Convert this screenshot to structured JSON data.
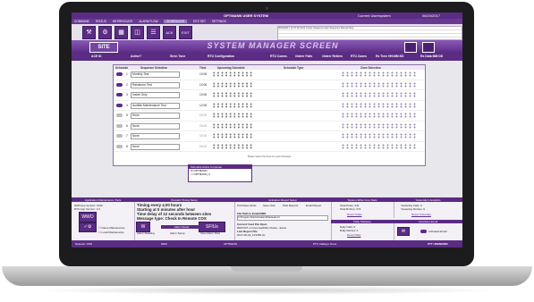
{
  "window": {
    "title": "OPTMANN USER SYSTEM",
    "user": "Current User/system",
    "date": "06/24/2017"
  },
  "menu": [
    "COMMAND",
    "STATUS",
    "INTERROGATE",
    "ALARM FLOW",
    "SCHEDULES",
    "SITE SET",
    "SETTINGS"
  ],
  "toolbar": {
    "buttons": [
      "wrench",
      "tools",
      "grid",
      "map",
      "list",
      "ack",
      "exit"
    ],
    "ack_label": "ACK",
    "exit_label": "EXIT",
    "log_rows": [
      "06/24/2017 12:47:36 2101   6   Auto Sequence   Auto Sequence Manual Stop",
      "",
      "",
      ""
    ]
  },
  "header": {
    "site_label": "SITE",
    "title": "SYSTEM MANAGER SCREEN"
  },
  "column_heads": [
    "ACE ID",
    "Active?",
    "Siren Tone",
    "RTU Configuration",
    "RTU Comm.",
    "#Interr Fails",
    "#Interr Retries",
    "RTU Zones",
    "Rx Time HH:MM:SS",
    "Rx Data MM:DD"
  ],
  "schedule": {
    "headers": [
      "Schedule",
      "Sequence Selection",
      "Time",
      "Upcoming Schedule",
      "Schedule Type",
      "Zone Selection"
    ],
    "rows": [
      {
        "num": "1",
        "active": true,
        "sequence": "Monthly Test",
        "time": "10:00"
      },
      {
        "num": "2",
        "active": true,
        "sequence": "Rainstorm Test",
        "time": "10:00"
      },
      {
        "num": "3",
        "active": true,
        "sequence": "Inside Only",
        "time": "10:00"
      },
      {
        "num": "4",
        "active": true,
        "sequence": "Audible Maintenance Test",
        "time": "12:00"
      },
      {
        "num": "5",
        "active": false,
        "sequence": "None",
        "time": "00:00"
      },
      {
        "num": "6",
        "active": false,
        "sequence": "None",
        "time": "00:00"
      },
      {
        "num": "7",
        "active": false,
        "sequence": "None",
        "time": "00:00"
      },
      {
        "num": "8",
        "active": false,
        "sequence": "None",
        "time": "00:00"
      }
    ],
    "note": "Please Select the Zone for each Schedule"
  },
  "popup": {
    "title": "Schedule Active Computer",
    "items": [
      "OPTMANN",
      "OPTMANN_2"
    ]
  },
  "bottom": {
    "app_maint": {
      "title": "Application Maintenance Tools",
      "lines": [
        "WWI App Version:  1000",
        "RTU App Version:  1.0"
      ],
      "checks": [
        "Name Maintenance",
        "Local Maintenance"
      ]
    },
    "periodic": {
      "title": "Periodic Timing Setup",
      "lines": [
        "Timing every 4.00 hours",
        "Starting at 0 minutes after hour",
        "Time delay of 12 seconds between sites",
        "Message type:  Check In  Remote COS"
      ],
      "alarm_title": "Alarm Setup",
      "alarm_items": [
        "Alarm Reading",
        "Alarm Setup",
        "View Alarm Files"
      ]
    },
    "activation": {
      "title": "Activation Report Setup",
      "buttons": [
        "Print/Save Ends",
        "Save Now",
        "Past Reports",
        "Email Report"
      ],
      "file_label": "File Path to Email/XMS",
      "file_path": "C:\\Program Files\\Activation\\Files\\Last.txt",
      "current_label": "Current Used File Open",
      "current_value": "REPORT on (Compatibility Mode) - Excel",
      "last_label": "Last Report File",
      "last_value": "2017-06-24_123456.xls"
    },
    "core_stats": {
      "title": "System-Wide Core Stats",
      "lines": [
        "Total Pulse: 242",
        "Total Rx/Imp: 273"
      ],
      "link": "Reset Totals"
    },
    "yesterday": {
      "title": "Yesterday's Analytics",
      "lines": [
        "Yesterday Fails: 0",
        "Yesterday Retries: 0"
      ],
      "link": "Reset Yesterday"
    },
    "daily": {
      "title": "Daily Statistics",
      "lines": [
        "Daily Fails: 0",
        "Daily Retries: 0"
      ],
      "link": "Reset Daily"
    },
    "email": {
      "title": "Activation Email",
      "label": "Activated Email"
    }
  },
  "statusbar": {
    "left": "Network: ONS",
    "mid1": "6000",
    "mid2": "OPTMANN",
    "mid3": "PTC Callsign: None",
    "right": "PTT UNKNOWN"
  },
  "colors": {
    "accent": "#5b2c83",
    "accent_light": "#8a5ab8"
  }
}
